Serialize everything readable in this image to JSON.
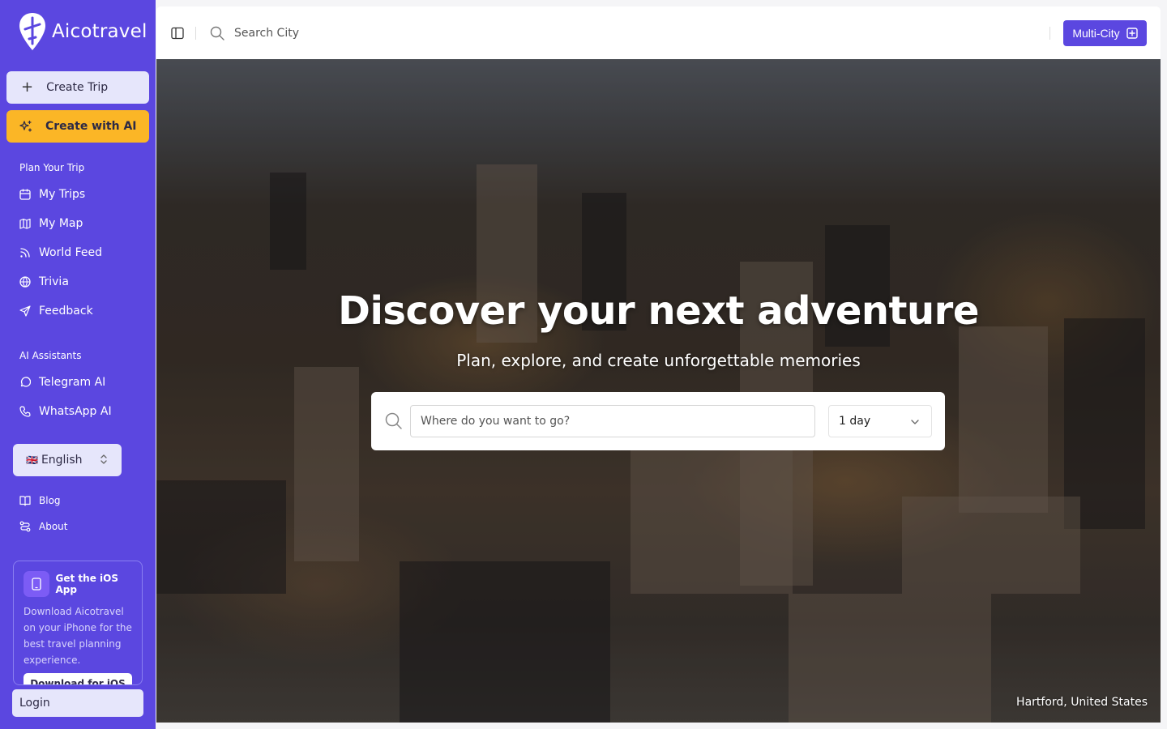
{
  "app": {
    "name": "Aicotravel"
  },
  "sidebar": {
    "create_trip": "Create Trip",
    "create_ai": "Create with AI",
    "plan_section": "Plan Your Trip",
    "plan_items": [
      {
        "label": "My Trips",
        "icon": "calendar-icon"
      },
      {
        "label": "My Map",
        "icon": "map-icon"
      },
      {
        "label": "World Feed",
        "icon": "rss-icon"
      },
      {
        "label": "Trivia",
        "icon": "globe-icon"
      },
      {
        "label": "Feedback",
        "icon": "send-icon"
      }
    ],
    "ai_section": "AI Assistants",
    "ai_items": [
      {
        "label": "Telegram AI",
        "icon": "message-circle-icon"
      },
      {
        "label": "WhatsApp AI",
        "icon": "phone-icon"
      }
    ],
    "language": {
      "flag": "🇬🇧",
      "label": "English"
    },
    "footer_links": [
      {
        "label": "Blog",
        "icon": "book-icon"
      },
      {
        "label": "About",
        "icon": "route-icon"
      }
    ],
    "ios_card": {
      "title": "Get the iOS App",
      "description": "Download Aicotravel on your iPhone for the best travel planning experience.",
      "button": "Download for iOS"
    },
    "login": "Login"
  },
  "topbar": {
    "search_placeholder": "Search City",
    "multi_city": "Multi-City"
  },
  "hero": {
    "title": "Discover your next adventure",
    "subtitle": "Plan, explore, and create unforgettable memories",
    "destination_placeholder": "Where do you want to go?",
    "duration": "1 day",
    "location": "Hartford, United States"
  },
  "colors": {
    "sidebar_bg": "#5b47e0",
    "ai_button": "#fbb626",
    "accent": "#5b47e0"
  }
}
